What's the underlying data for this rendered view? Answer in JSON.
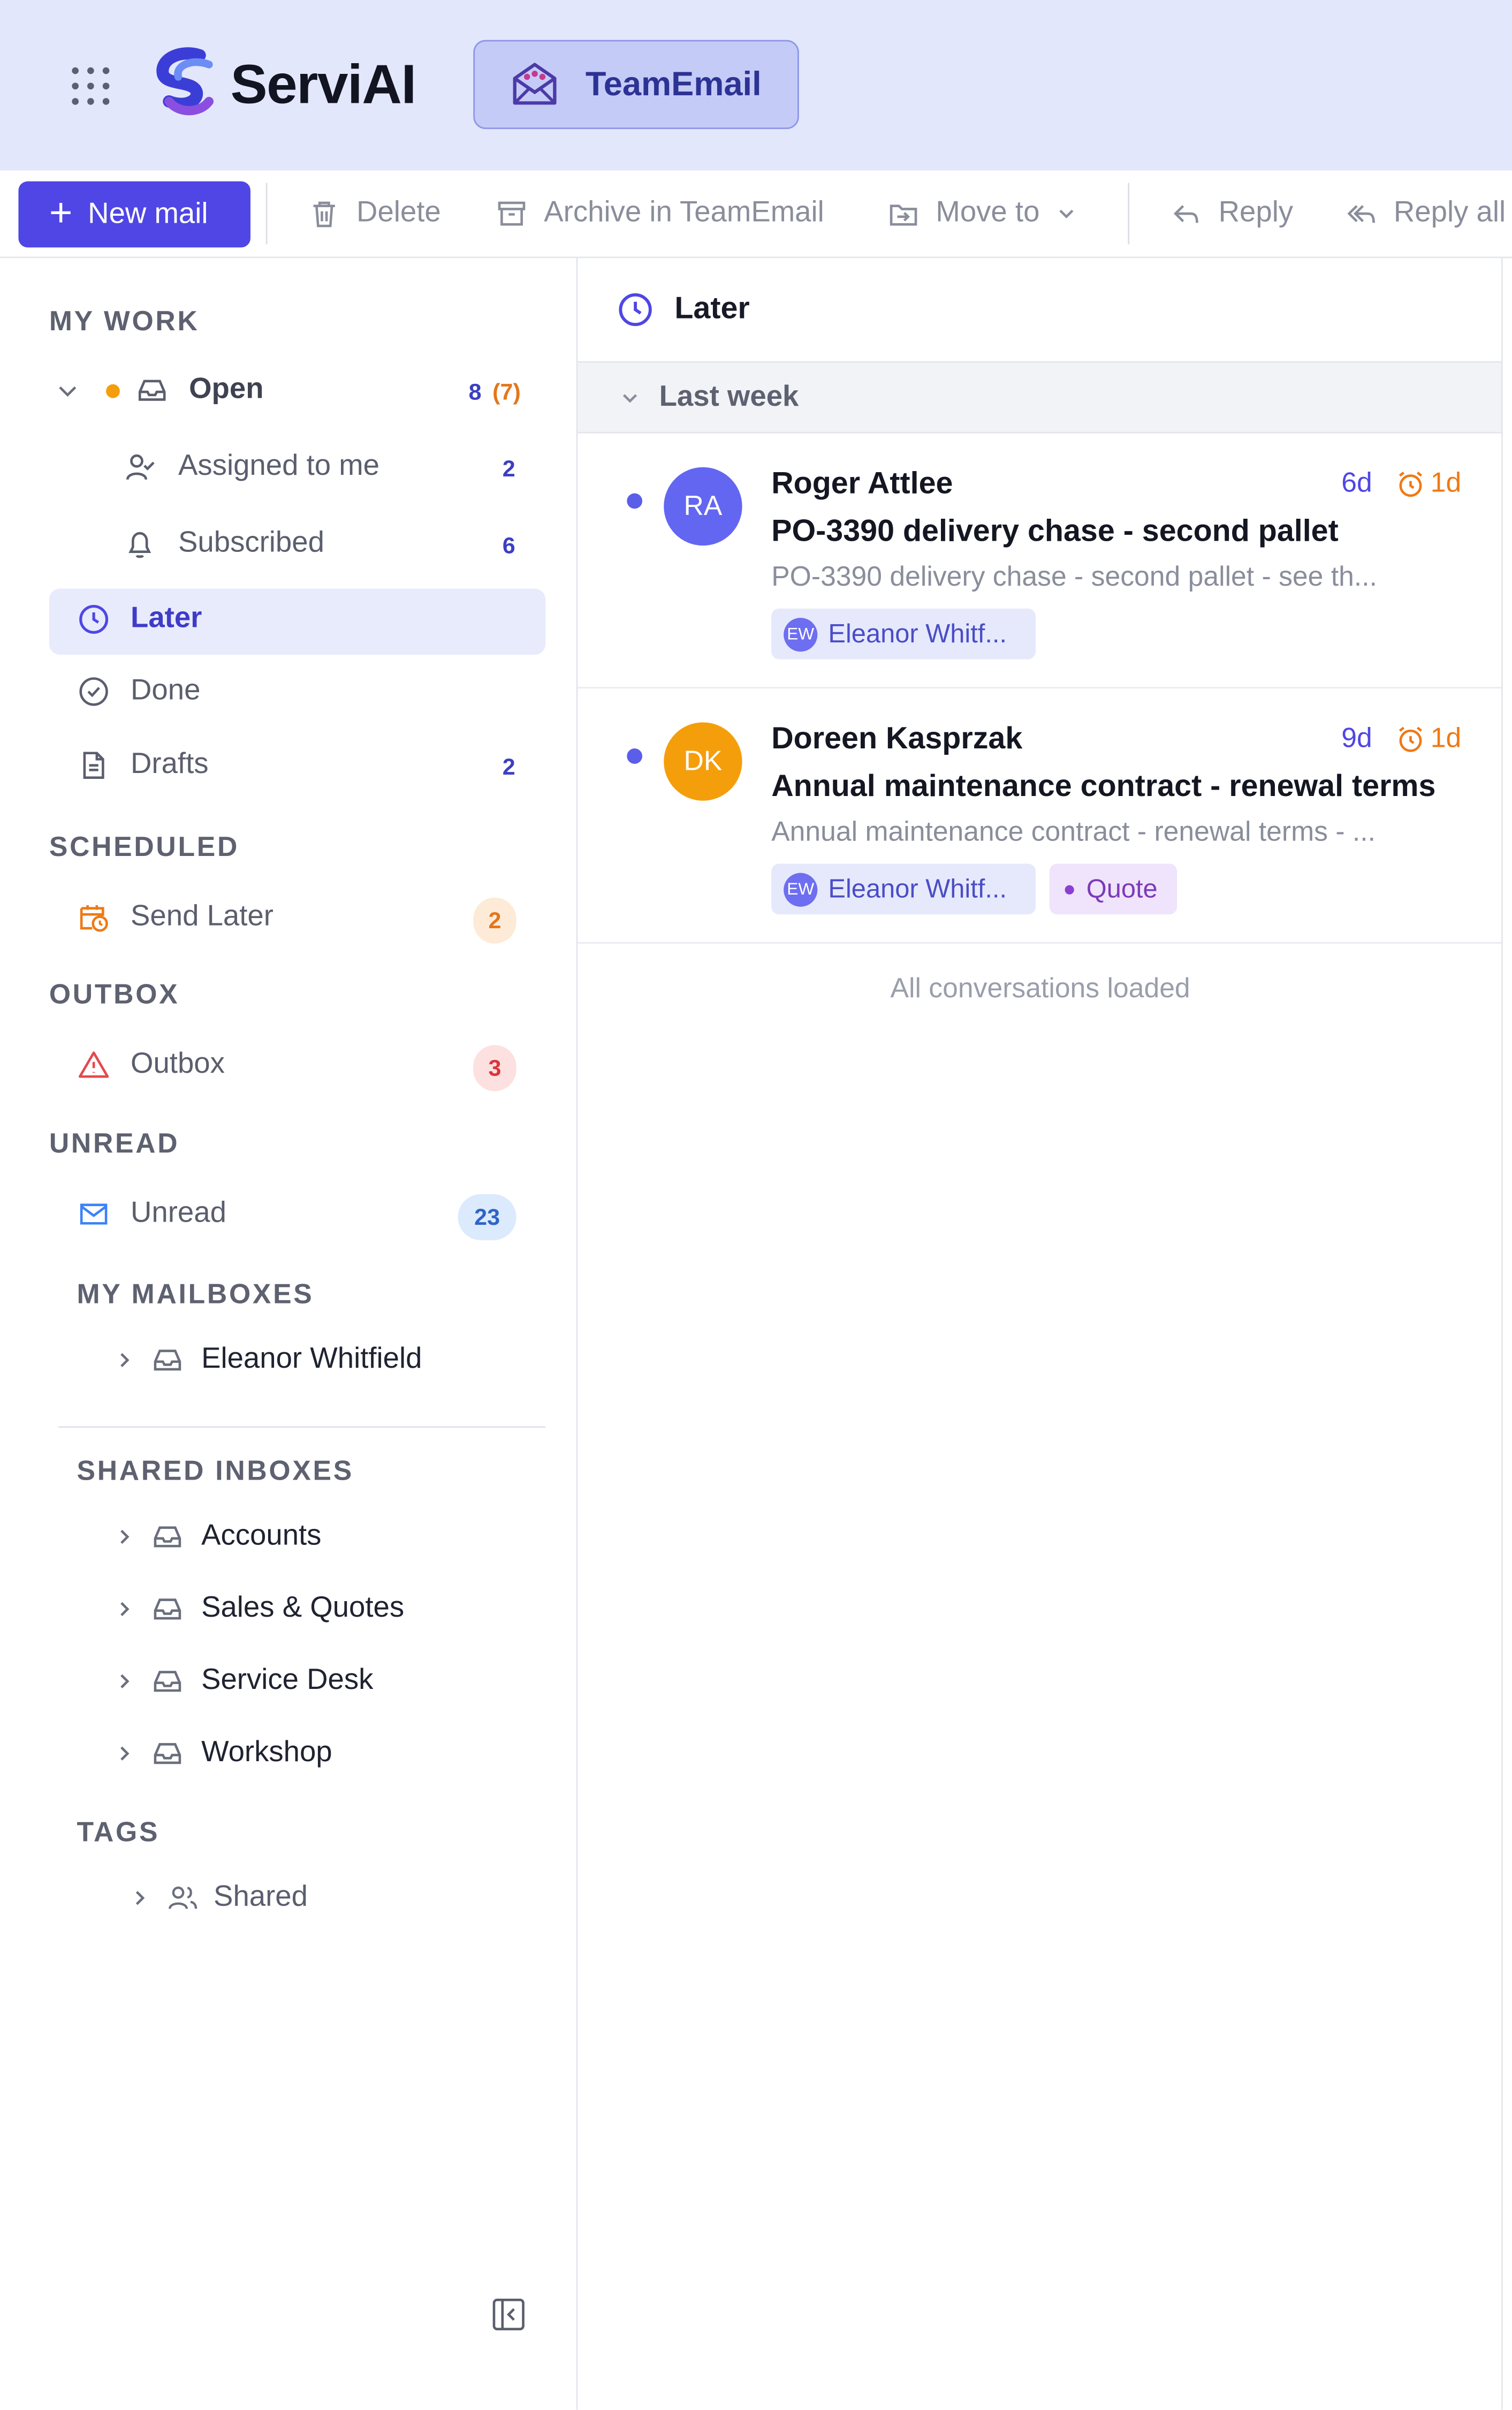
{
  "brand": {
    "name": "ServiAI",
    "app_pill": "TeamEmail"
  },
  "toolbar": {
    "new_mail": "New mail",
    "delete": "Delete",
    "archive": "Archive in TeamEmail",
    "move_to": "Move to",
    "reply": "Reply",
    "reply_all": "Reply all"
  },
  "sidebar": {
    "my_work": {
      "title": "MY WORK",
      "open": {
        "label": "Open",
        "count": "8",
        "count_extra": "(7)"
      },
      "assigned": {
        "label": "Assigned to me",
        "count": "2"
      },
      "subscribed": {
        "label": "Subscribed",
        "count": "6"
      },
      "later": {
        "label": "Later"
      },
      "done": {
        "label": "Done"
      },
      "drafts": {
        "label": "Drafts",
        "count": "2"
      }
    },
    "scheduled": {
      "title": "SCHEDULED",
      "send_later": {
        "label": "Send Later",
        "count": "2"
      }
    },
    "outbox": {
      "title": "OUTBOX",
      "item": {
        "label": "Outbox",
        "count": "3"
      }
    },
    "unread": {
      "title": "UNREAD",
      "item": {
        "label": "Unread",
        "count": "23"
      }
    },
    "my_mailboxes": {
      "title": "MY MAILBOXES",
      "items": [
        "Eleanor Whitfield"
      ]
    },
    "shared_inboxes": {
      "title": "SHARED INBOXES",
      "items": [
        "Accounts",
        "Sales & Quotes",
        "Service Desk",
        "Workshop"
      ]
    },
    "tags": {
      "title": "TAGS",
      "items": [
        "Shared"
      ]
    }
  },
  "main": {
    "header": "Later",
    "group": "Last week",
    "conversations": [
      {
        "initials": "RA",
        "avatar_color": "#6366f1",
        "sender": "Roger Attlee",
        "age": "6d",
        "snooze": "1d",
        "subject": "PO-3390 delivery chase - second pallet",
        "preview": "PO-3390 delivery chase - second pallet - see th...",
        "assignee_initials": "EW",
        "assignee": "Eleanor Whitf..."
      },
      {
        "initials": "DK",
        "avatar_color": "#f59e0b",
        "sender": "Doreen Kasprzak",
        "age": "9d",
        "snooze": "1d",
        "subject": "Annual maintenance contract - renewal terms",
        "preview": "Annual maintenance contract - renewal terms - ...",
        "assignee_initials": "EW",
        "assignee": "Eleanor Whitf...",
        "tag": "Quote"
      }
    ],
    "footer": "All conversations loaded"
  },
  "colors": {
    "accent": "#4f46e5",
    "topbar": "#e3e7fb",
    "snooze": "#f07913"
  }
}
